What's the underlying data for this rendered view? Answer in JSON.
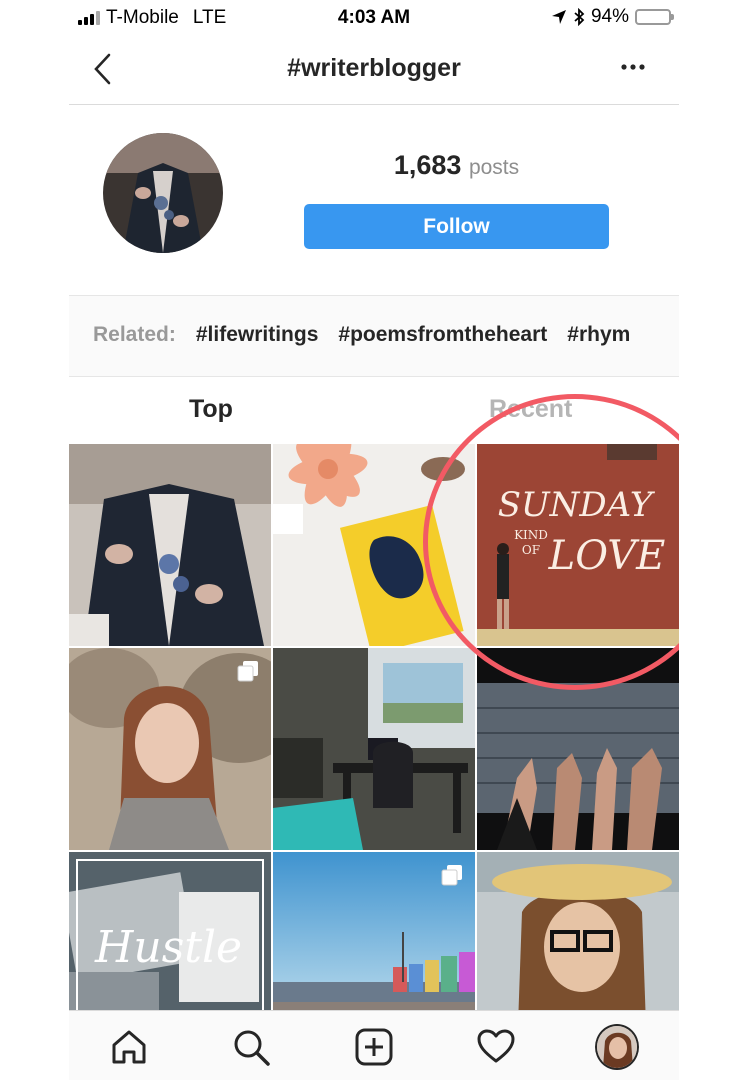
{
  "status_bar": {
    "carrier": "T-Mobile",
    "network": "LTE",
    "time": "4:03 AM",
    "battery": "94%"
  },
  "nav": {
    "title": "#writerblogger"
  },
  "profile": {
    "count": "1,683",
    "count_label": "posts",
    "follow_label": "Follow"
  },
  "related": {
    "label": "Related:",
    "tags": [
      "#lifewritings",
      "#poemsfromtheheart",
      "#rhym"
    ]
  },
  "tabs": [
    {
      "label": "Top",
      "active": true
    },
    {
      "label": "Recent",
      "active": false
    }
  ],
  "grid": {
    "posts": [
      {
        "name": "post-jacket-flowers",
        "multi": false
      },
      {
        "name": "post-book-flower",
        "multi": false
      },
      {
        "name": "post-sunday-kind-of-love",
        "text": [
          "SUNDAY",
          "KIND",
          "OF",
          "LOVE"
        ],
        "multi": false
      },
      {
        "name": "post-selfie-rocks",
        "multi": true
      },
      {
        "name": "post-desk-room",
        "multi": false
      },
      {
        "name": "post-hands-letters",
        "multi": false
      },
      {
        "name": "post-hustle-laptop",
        "text": "Hustle",
        "multi": false
      },
      {
        "name": "post-beach-huts",
        "multi": true
      },
      {
        "name": "post-selfie-hat",
        "multi": false
      }
    ]
  },
  "colors": {
    "follow_blue": "#3897f0",
    "highlight_circle": "#f25a64",
    "battery": "#f5c400"
  },
  "bottom_nav": [
    "home-icon",
    "search-icon",
    "add-post-icon",
    "activity-heart-icon",
    "profile-avatar"
  ]
}
